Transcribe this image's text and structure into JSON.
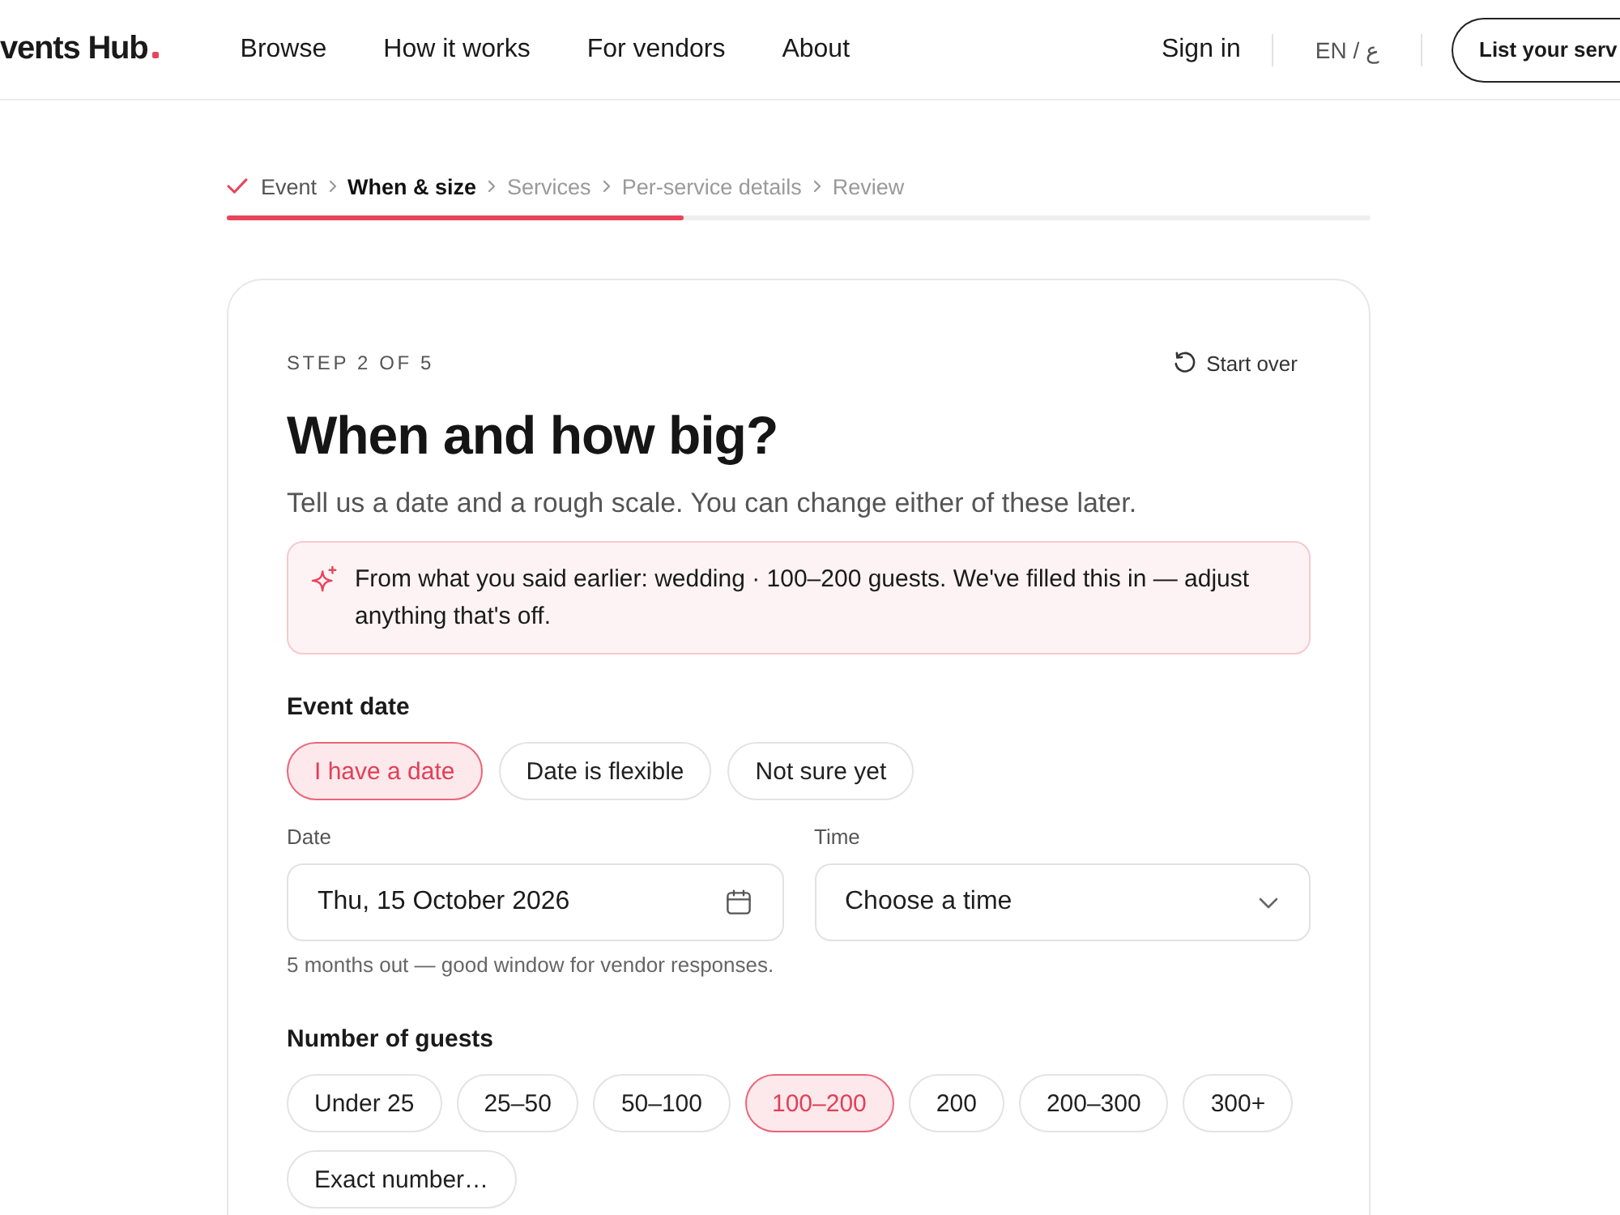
{
  "header": {
    "logo": "vents Hub",
    "nav": [
      {
        "label": "Browse"
      },
      {
        "label": "How it works"
      },
      {
        "label": "For vendors"
      },
      {
        "label": "About"
      }
    ],
    "sign_in": "Sign in",
    "language": "EN / ع",
    "cta": "List your serv"
  },
  "stepper": {
    "steps": [
      {
        "label": "Event",
        "done": true,
        "selected": false
      },
      {
        "label": "When & size",
        "done": false,
        "selected": true
      },
      {
        "label": "Services",
        "done": false,
        "selected": false
      },
      {
        "label": "Per-service details",
        "done": false,
        "selected": false
      },
      {
        "label": "Review",
        "done": false,
        "selected": false
      }
    ],
    "progress": {
      "level": 0.4
    }
  },
  "card": {
    "step_label": "STEP 2 OF 5",
    "start_over": "Start over",
    "title": "When and how big?",
    "subtitle": "Tell us a date and a rough scale. You can change either of these later.",
    "notice": "From what you said earlier: wedding · 100–200 guests. We've filled this in — adjust anything that's off.",
    "event_date": {
      "label": "Event date",
      "options": [
        {
          "label": "I have a date",
          "selected": true
        },
        {
          "label": "Date is flexible",
          "selected": false
        },
        {
          "label": "Not sure yet",
          "selected": false
        }
      ]
    },
    "date_field": {
      "label": "Date",
      "value": "Thu, 15 October 2026"
    },
    "time_field": {
      "label": "Time",
      "placeholder": "Choose a time"
    },
    "hint": "5 months out — good window for vendor responses.",
    "guests": {
      "label": "Number of guests",
      "options": [
        {
          "label": "Under 25",
          "selected": false
        },
        {
          "label": "25–50",
          "selected": false
        },
        {
          "label": "50–100",
          "selected": false
        },
        {
          "label": "100–200",
          "selected": true
        },
        {
          "label": "200",
          "selected": false
        },
        {
          "label": "200–300",
          "selected": false
        },
        {
          "label": "300+",
          "selected": false
        },
        {
          "label": "Exact number…",
          "selected": false
        }
      ]
    }
  }
}
